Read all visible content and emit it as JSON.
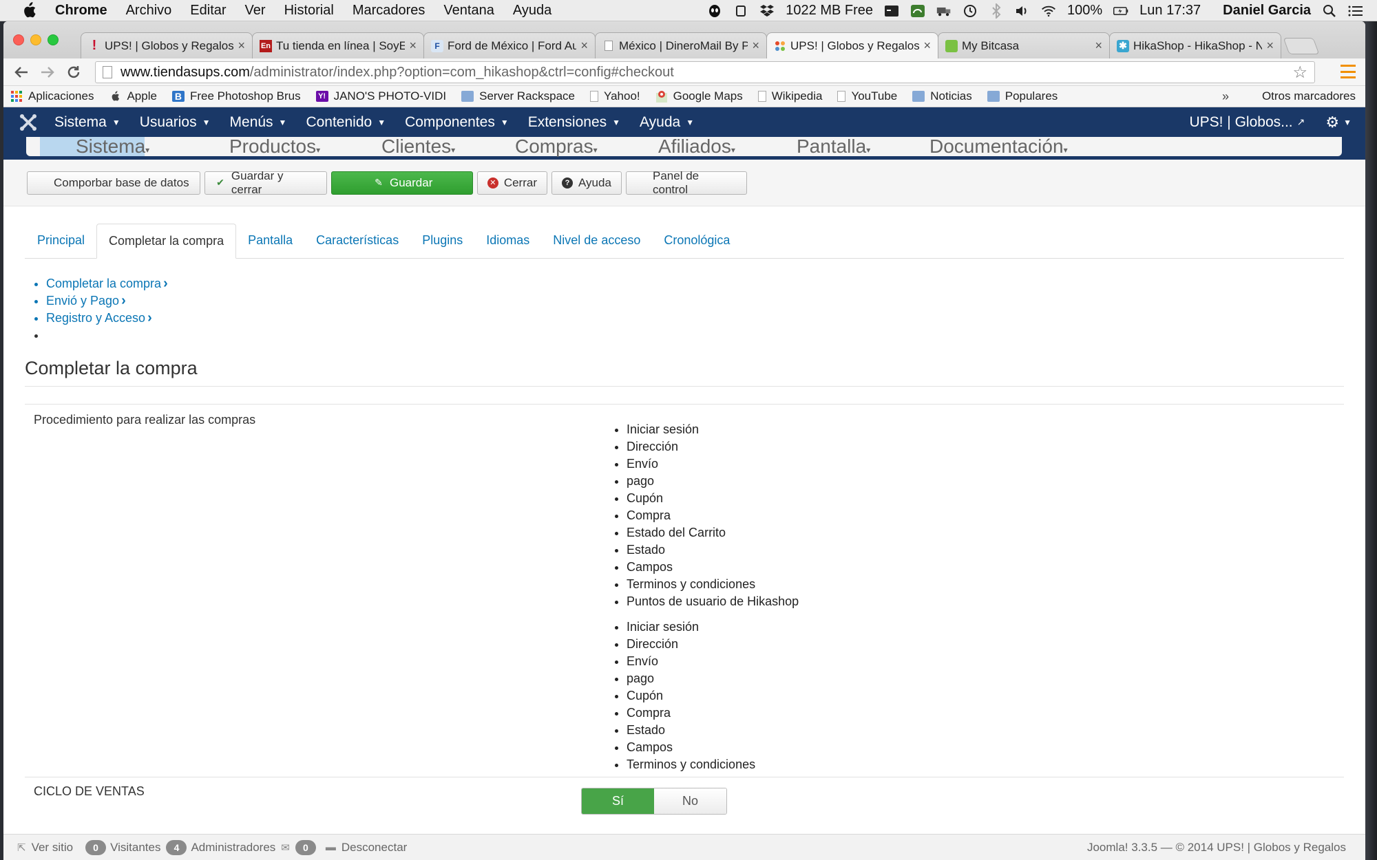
{
  "mac_menubar": {
    "app_name": "Chrome",
    "items": [
      "Archivo",
      "Editar",
      "Ver",
      "Historial",
      "Marcadores",
      "Ventana",
      "Ayuda"
    ],
    "memory": "1022 MB Free",
    "battery": "100%",
    "clock": "Lun 17:37",
    "user": "Daniel Garcia"
  },
  "browser": {
    "tabs": [
      {
        "title": "UPS! | Globos y Regalos",
        "icon": "exclamation-icon",
        "active": false
      },
      {
        "title": "Tu tienda en línea | SoyE",
        "icon": "en-icon",
        "active": false
      },
      {
        "title": "Ford de México | Ford Au",
        "icon": "ford-icon",
        "active": false
      },
      {
        "title": "México | DineroMail By P",
        "icon": "page-icon",
        "active": false
      },
      {
        "title": "UPS! | Globos y Regalos",
        "icon": "joomla-icon",
        "active": true
      },
      {
        "title": "My Bitcasa",
        "icon": "bitcasa-icon",
        "active": false
      },
      {
        "title": "HikaShop - HikaShop - N",
        "icon": "hikashop-icon",
        "active": false
      }
    ],
    "url_domain": "www.tiendasups.com",
    "url_path": "/administrator/index.php?option=com_hikashop&ctrl=config#checkout",
    "bookmarks": [
      "Aplicaciones",
      "Apple",
      "Free Photoshop Brus",
      "JANO'S PHOTO-VIDI",
      "Server Rackspace",
      "Yahoo!",
      "Google Maps",
      "Wikipedia",
      "YouTube",
      "Noticias",
      "Populares"
    ],
    "bookmarks_other": "Otros marcadores",
    "bookmarks_overflow": "»"
  },
  "joomla": {
    "menu": [
      "Sistema",
      "Usuarios",
      "Menús",
      "Contenido",
      "Componentes",
      "Extensiones",
      "Ayuda"
    ],
    "site_name": "UPS! | Globos...",
    "submenu": [
      "Sistema",
      "Productos",
      "Clientes",
      "Compras",
      "Afiliados",
      "Pantalla",
      "Documentación"
    ],
    "toolbar": {
      "check_db": "Comporbar base de datos",
      "save_close": "Guardar y cerrar",
      "save": "Guardar",
      "close": "Cerrar",
      "help": "Ayuda",
      "control_panel": "Panel de control"
    },
    "tabs": [
      "Principal",
      "Completar la compra",
      "Pantalla",
      "Características",
      "Plugins",
      "Idiomas",
      "Nivel de acceso",
      "Cronológica"
    ],
    "section_links": [
      "Completar la compra",
      "Envió y Pago",
      "Registro y Acceso"
    ],
    "heading": "Completar la compra",
    "procedure_label": "Procedimiento para realizar las compras",
    "steps_a": [
      "Iniciar sesión",
      "Dirección",
      "Envío",
      "pago",
      "Cupón",
      "Compra",
      "Estado del Carrito",
      "Estado",
      "Campos",
      "Terminos y condiciones",
      "Puntos de usuario de Hikashop"
    ],
    "steps_b": [
      "Iniciar sesión",
      "Dirección",
      "Envío",
      "pago",
      "Cupón",
      "Compra",
      "Estado",
      "Campos",
      "Terminos y condiciones"
    ],
    "sales_cycle_label": "CICLO DE VENTAS",
    "toggle_yes": "Sí",
    "toggle_no": "No",
    "status": {
      "view_site": "Ver sitio",
      "visitors_count": "0",
      "visitors": "Visitantes",
      "admins_count": "4",
      "admins": "Administradores",
      "messages_count": "0",
      "logout": "Desconectar",
      "footer": "Joomla! 3.3.5  —  © 2014 UPS! | Globos y Regalos"
    }
  }
}
